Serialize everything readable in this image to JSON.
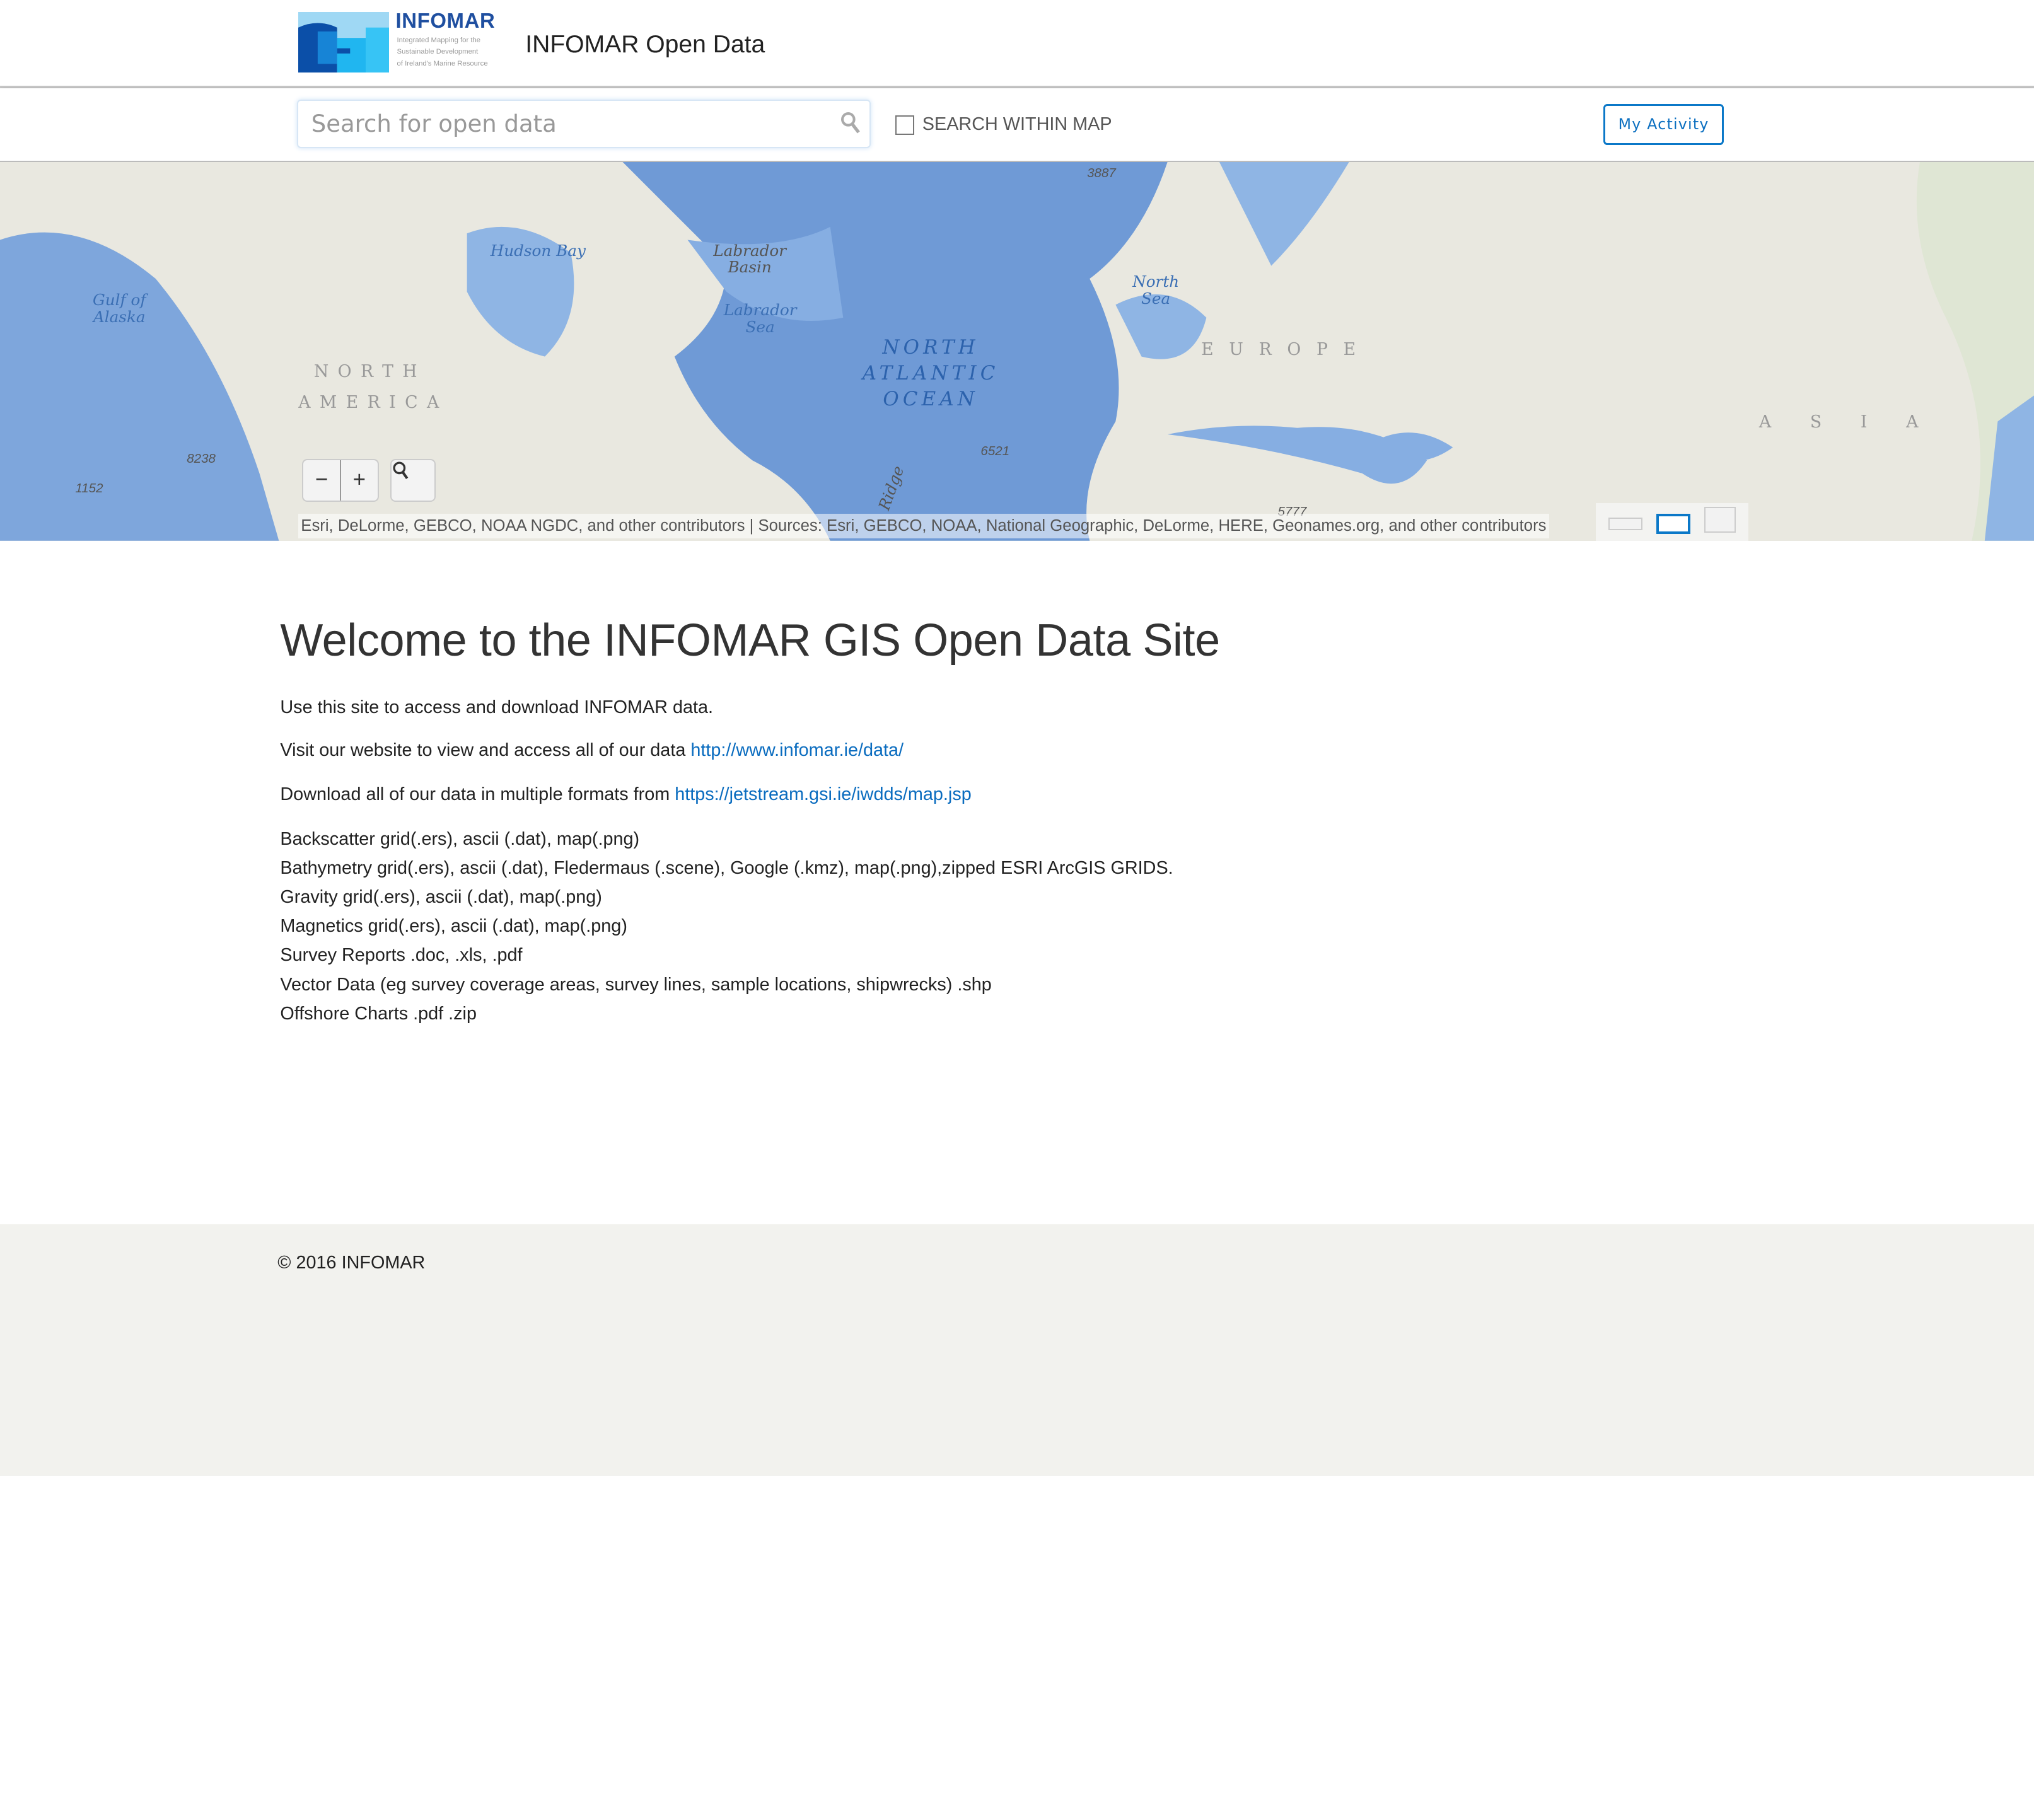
{
  "header": {
    "logo_word": "INFOMAR",
    "logo_tagline": [
      "Integrated Mapping for the",
      "Sustainable Development",
      "of Ireland's Marine Resource"
    ],
    "title": "INFOMAR Open Data"
  },
  "search": {
    "placeholder": "Search for open data",
    "value": "",
    "within_map_label": "SEARCH WITHIN MAP",
    "within_map_checked": false,
    "my_activity_label": "My Activity"
  },
  "map": {
    "labels": {
      "hudson": "Hudson Bay",
      "labrador_basin": "Labrador Basin",
      "labrador_sea": "Labrador Sea",
      "gulf_alaska": "Gulf of Alaska",
      "north_sea": "North Sea",
      "north_atlantic": "NORTH ATLANTIC OCEAN",
      "north_america_1": "NORTH",
      "north_america_2": "AMERICA",
      "europe": "EUROPE",
      "asia": "ASIA",
      "ridge": "Ridge"
    },
    "depths": [
      "3887",
      "8238",
      "1152",
      "6521",
      "5777"
    ],
    "zoom_out": "−",
    "zoom_in": "+",
    "attribution": "Esri, DeLorme, GEBCO, NOAA NGDC, and other contributors | Sources: Esri, GEBCO, NOAA, National Geographic, DeLorme, HERE, Geonames.org, and other contributors",
    "active_basemap": 2
  },
  "content": {
    "heading": "Welcome to the INFOMAR GIS Open Data Site",
    "intro": "Use this site to access and download INFOMAR data.",
    "visit_text": "Visit our website to view and access all of our data ",
    "visit_link": "http://www.infomar.ie/data/",
    "download_text": "Download all of our data in multiple formats from ",
    "download_link": "https://jetstream.gsi.ie/iwdds/map.jsp",
    "formats": [
      "Backscatter grid(.ers), ascii (.dat), map(.png)",
      "Bathymetry grid(.ers), ascii (.dat), Fledermaus (.scene), Google (.kmz), map(.png),zipped ESRI ArcGIS GRIDS.",
      "Gravity grid(.ers), ascii (.dat), map(.png)",
      "Magnetics grid(.ers), ascii (.dat), map(.png)",
      "Survey Reports .doc, .xls, .pdf",
      "Vector Data (eg survey coverage areas, survey lines, sample locations, shipwrecks) .shp",
      "Offshore Charts .pdf .zip"
    ]
  },
  "footer": {
    "copyright": "© 2016 INFOMAR"
  },
  "colors": {
    "accent": "#0b78c8",
    "ocean": "#7ea6dc",
    "land": "#e9e8e0",
    "footer_bg": "#f2f2ee"
  }
}
